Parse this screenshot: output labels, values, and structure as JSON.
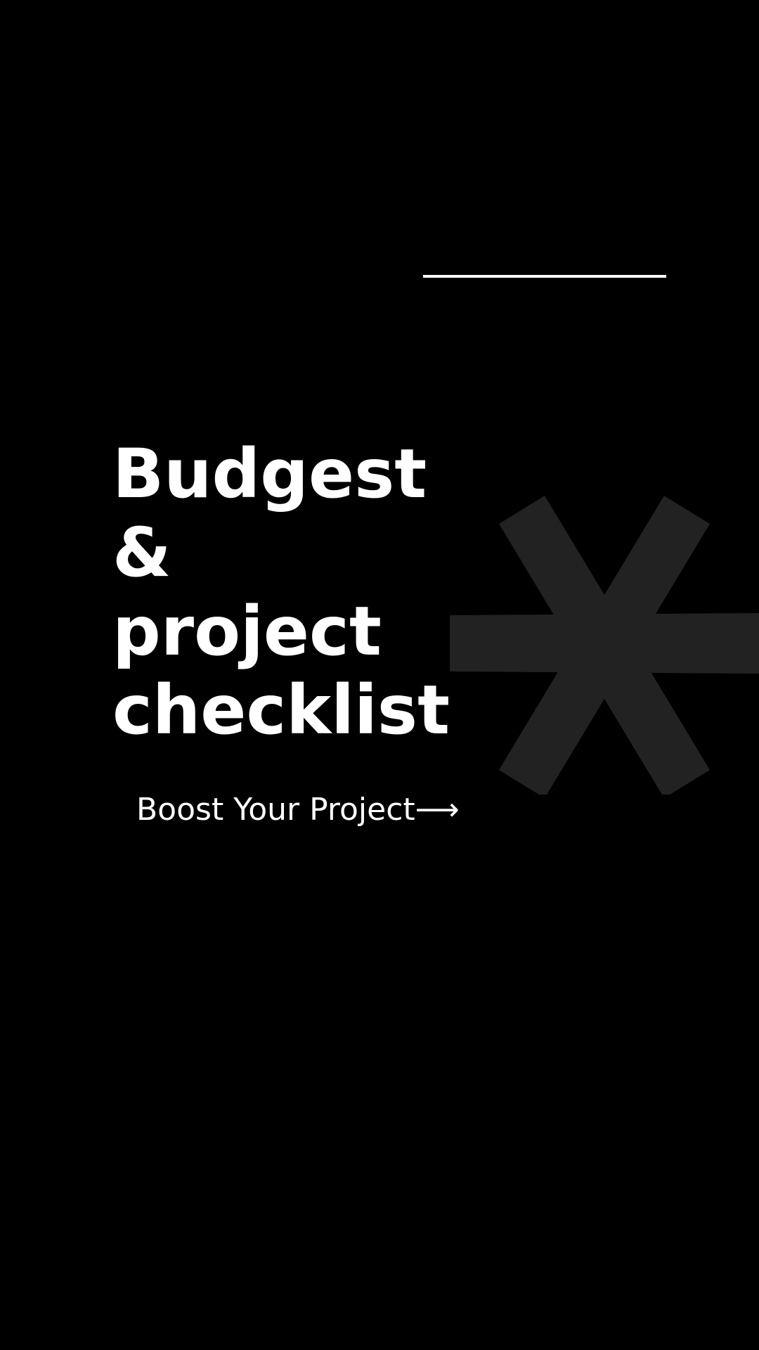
{
  "colors": {
    "background": "#000000",
    "text": "#ffffff",
    "rule": "#ffffff",
    "asterisk": "#222222"
  },
  "decoration": {
    "icon": "asterisk-icon"
  },
  "title": {
    "lines": [
      "Budgest",
      "&",
      "project",
      "checklist"
    ]
  },
  "cta": {
    "label": "Boost Your Project",
    "arrow": "⟶"
  }
}
